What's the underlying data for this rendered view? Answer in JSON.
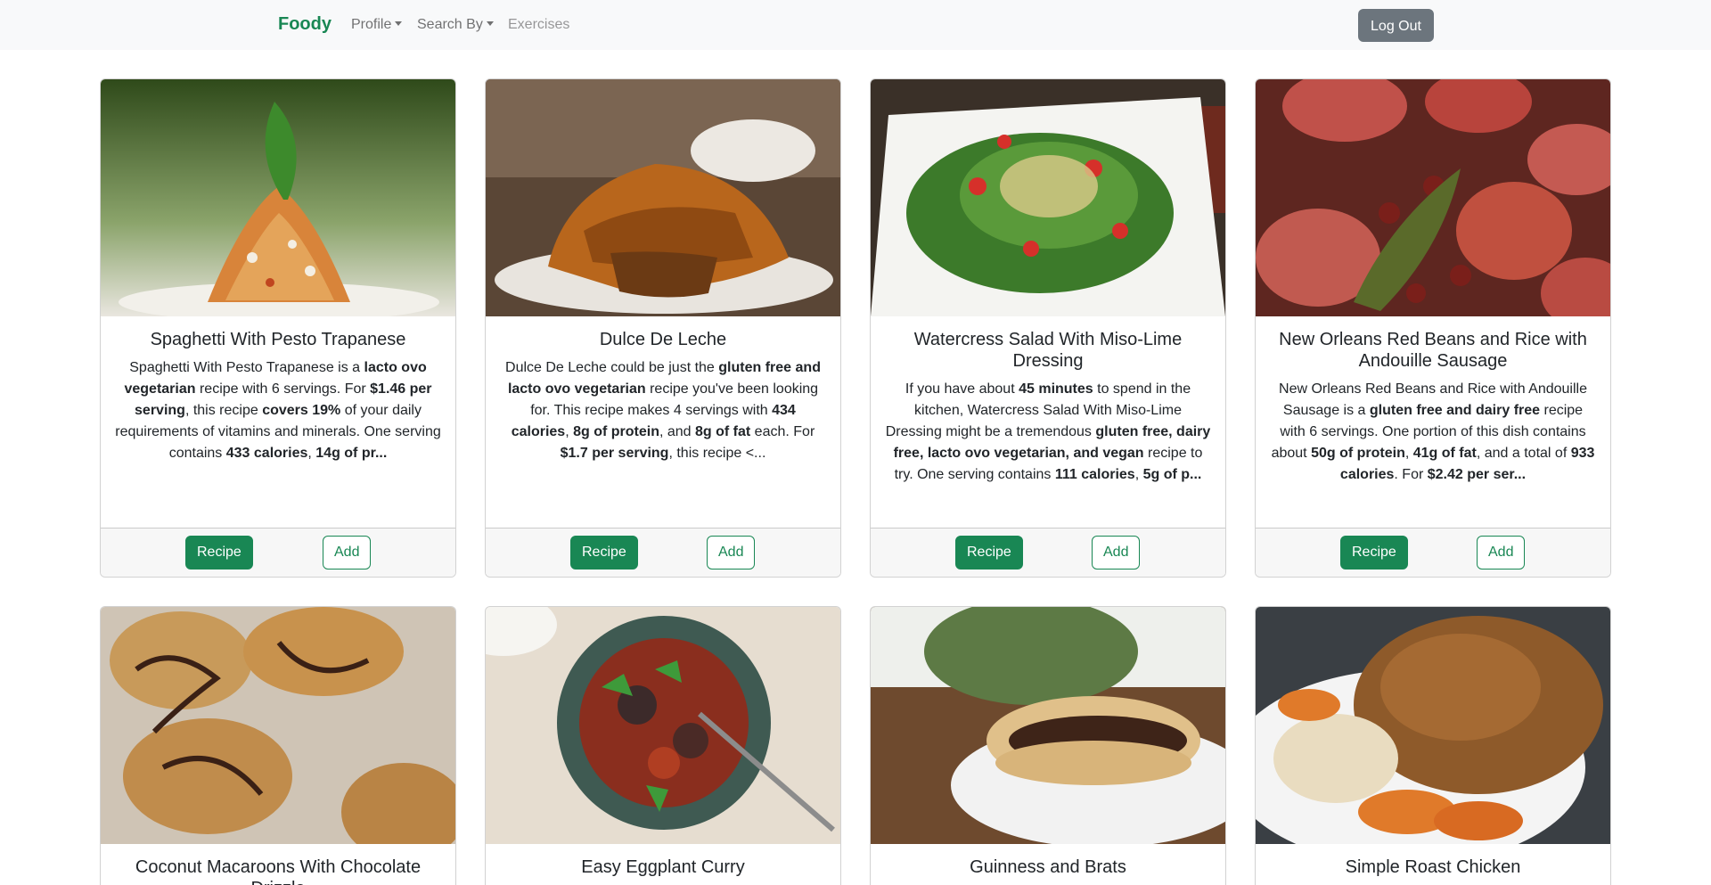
{
  "navbar": {
    "brand": "Foody",
    "items": [
      {
        "label": "Profile",
        "dropdown": true
      },
      {
        "label": "Search By",
        "dropdown": true
      },
      {
        "label": "Exercises",
        "dropdown": false
      }
    ],
    "logout_label": "Log Out"
  },
  "buttons": {
    "recipe_label": "Recipe",
    "add_label": "Add"
  },
  "colors": {
    "brand": "#198754",
    "secondary": "#6c757d"
  },
  "recipes": [
    {
      "title": "Spaghetti With Pesto Trapanese",
      "description": [
        {
          "t": "Spaghetti With Pesto Trapanese is a "
        },
        {
          "t": "lacto ovo vegetarian",
          "b": true
        },
        {
          "t": " recipe with 6 servings. For "
        },
        {
          "t": "$1.46 per serving",
          "b": true
        },
        {
          "t": ", this recipe "
        },
        {
          "t": "covers 19%",
          "b": true
        },
        {
          "t": " of your daily requirements of vitamins and minerals. One serving contains "
        },
        {
          "t": "433 calories",
          "b": true
        },
        {
          "t": ", "
        },
        {
          "t": "14g of pr...",
          "b": true
        }
      ]
    },
    {
      "title": "Dulce De Leche",
      "description": [
        {
          "t": "Dulce De Leche could be just the "
        },
        {
          "t": "gluten free and lacto ovo vegetarian",
          "b": true
        },
        {
          "t": " recipe you've been looking for. This recipe makes 4 servings with "
        },
        {
          "t": "434 calories",
          "b": true
        },
        {
          "t": ", "
        },
        {
          "t": "8g of protein",
          "b": true
        },
        {
          "t": ", and "
        },
        {
          "t": "8g of fat",
          "b": true
        },
        {
          "t": " each. For "
        },
        {
          "t": "$1.7 per serving",
          "b": true
        },
        {
          "t": ", this recipe <..."
        }
      ]
    },
    {
      "title": "Watercress Salad With Miso-Lime Dressing",
      "description": [
        {
          "t": "If you have about "
        },
        {
          "t": "45 minutes",
          "b": true
        },
        {
          "t": " to spend in the kitchen, Watercress Salad With Miso-Lime Dressing might be a tremendous "
        },
        {
          "t": "gluten free, dairy free, lacto ovo vegetarian, and vegan",
          "b": true
        },
        {
          "t": " recipe to try. One serving contains "
        },
        {
          "t": "111 calories",
          "b": true
        },
        {
          "t": ", "
        },
        {
          "t": "5g of p...",
          "b": true
        }
      ]
    },
    {
      "title": "New Orleans Red Beans and Rice with Andouille Sausage",
      "description": [
        {
          "t": "New Orleans Red Beans and Rice with Andouille Sausage is a "
        },
        {
          "t": "gluten free and dairy free",
          "b": true
        },
        {
          "t": " recipe with 6 servings. One portion of this dish contains about "
        },
        {
          "t": "50g of protein",
          "b": true
        },
        {
          "t": ", "
        },
        {
          "t": "41g of fat",
          "b": true
        },
        {
          "t": ", and a total of "
        },
        {
          "t": "933 calories",
          "b": true
        },
        {
          "t": ". For "
        },
        {
          "t": "$2.42 per ser...",
          "b": true
        }
      ]
    },
    {
      "title": "Coconut Macaroons With Chocolate Drizzle",
      "description": []
    },
    {
      "title": "Easy Eggplant Curry",
      "description": []
    },
    {
      "title": "Guinness and Brats",
      "description": []
    },
    {
      "title": "Simple Roast Chicken",
      "description": []
    }
  ]
}
